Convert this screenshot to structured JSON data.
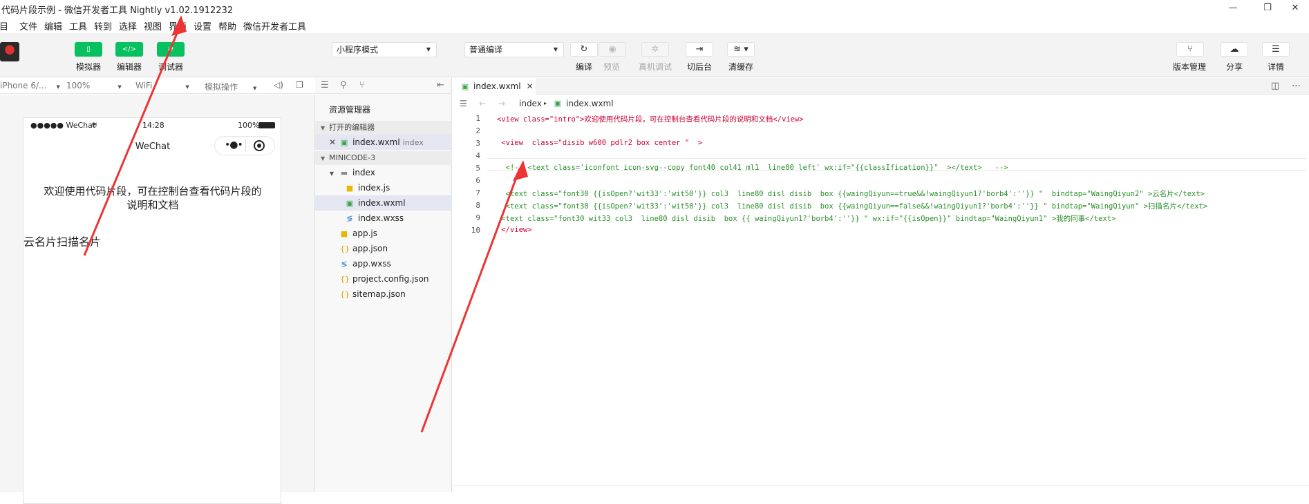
{
  "window": {
    "title": "代码片段示例 - 微信开发者工具 Nightly v1.02.1912232",
    "minimize": "—",
    "restore": "❐",
    "close": "✕"
  },
  "menu": [
    "项目",
    "文件",
    "编辑",
    "工具",
    "转到",
    "选择",
    "视图",
    "界面",
    "设置",
    "帮助",
    "微信开发者工具"
  ],
  "toolbar": {
    "simulator_label": "模拟器",
    "editor_label": "编辑器",
    "debugger_label": "调试器",
    "mode_select": "小程序模式",
    "compile_select": "普通编译",
    "compile_label": "编译",
    "preview_label": "预览",
    "remote_debug_label": "真机调试",
    "background_label": "切后台",
    "clear_cache_label": "清缓存",
    "version_label": "版本管理",
    "share_label": "分享",
    "detail_label": "详情"
  },
  "simbar": {
    "device": "iPhone 6/...",
    "zoom": "100%",
    "network": "WiFi",
    "operation": "模拟操作"
  },
  "phone": {
    "signal": "●●●●● WeChat",
    "time": "14:28",
    "battery": "100%",
    "nav_title": "WeChat",
    "intro_text": "欢迎使用代码片段，可在控制台查看代码片段的说明和文档",
    "card_text": "云名片扫描名片"
  },
  "explorer": {
    "title": "资源管理器",
    "open_editors": "打开的编辑器",
    "open_file": "index.wxml",
    "open_file_note": "index",
    "project": "MINICODE-3",
    "folder": "index",
    "files_in_folder": [
      "index.js",
      "index.wxml",
      "index.wxss"
    ],
    "root_files": [
      "app.js",
      "app.json",
      "app.wxss",
      "project.config.json",
      "sitemap.json"
    ]
  },
  "editor": {
    "tab": "index.wxml",
    "crumb_folder": "index",
    "crumb_file": "index.wxml",
    "lines": [
      "<view class=\"intro\">欢迎使用代码片段，可在控制台查看代码片段的说明和文档</view>",
      "",
      " <view  class=\"disib w600 pdlr2 box center \"  >",
      "",
      "  <!-- <text class='iconfont icon-svg--copy font40 col41 ml1  line80 left' wx:if=\"{{classIfication}}\"  ></text>   -->",
      "",
      "  <text class=\"font30 {{isOpen?'wit33':'wit50'}} col3  line80 disl disib  box {{waingQiyun==true&&!waingQiyun1?'borb4':''}} \"  bindtap=\"WaingQiyun2\" >云名片</text>",
      "  <text class=\"font30 {{isOpen?'wit33':'wit50'}} col3  line80 disl disib  box {{waingQiyun==false&&!waingQiyun1?'borb4':''}} \" bindtap=\"WaingQiyun\" >扫描名片</text>",
      " <text class=\"font30 wit33 col3  line80 disl disib  box {{ waingQiyun1?'borb4':''}} \" wx:if=\"{{isOpen}}\" bindtap=\"WaingQiyun1\" >我的同事</text>",
      " </view>"
    ]
  }
}
